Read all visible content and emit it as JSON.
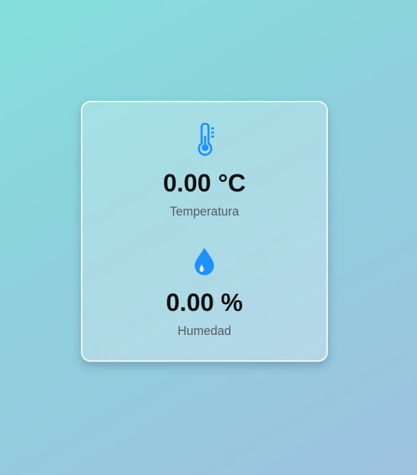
{
  "colors": {
    "accent": "#1e90ff",
    "value_text": "#111111",
    "label_text": "#555b60"
  },
  "temperature": {
    "icon": "thermometer-icon",
    "value": "0.00 °C",
    "label": "Temperatura"
  },
  "humidity": {
    "icon": "water-drop-icon",
    "value": "0.00 %",
    "label": "Humedad"
  }
}
